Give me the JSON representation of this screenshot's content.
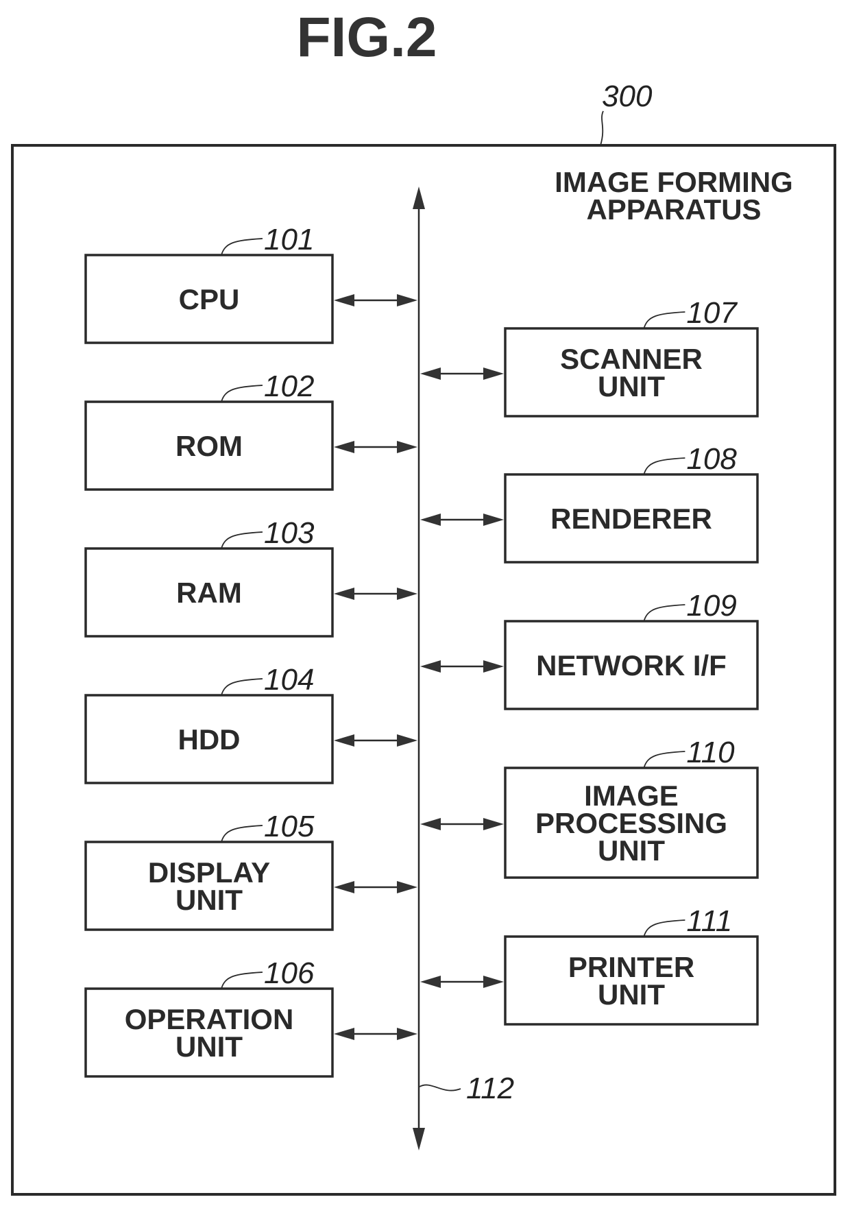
{
  "figure": {
    "title": "FIG.2",
    "apparatus_ref": "300",
    "apparatus_label": [
      "IMAGE FORMING",
      "APPARATUS"
    ],
    "bus_ref": "112"
  },
  "left_blocks": [
    {
      "ref": "101",
      "label": [
        "CPU"
      ]
    },
    {
      "ref": "102",
      "label": [
        "ROM"
      ]
    },
    {
      "ref": "103",
      "label": [
        "RAM"
      ]
    },
    {
      "ref": "104",
      "label": [
        "HDD"
      ]
    },
    {
      "ref": "105",
      "label": [
        "DISPLAY",
        "UNIT"
      ]
    },
    {
      "ref": "106",
      "label": [
        "OPERATION",
        "UNIT"
      ]
    }
  ],
  "right_blocks": [
    {
      "ref": "107",
      "label": [
        "SCANNER",
        "UNIT"
      ]
    },
    {
      "ref": "108",
      "label": [
        "RENDERER"
      ]
    },
    {
      "ref": "109",
      "label": [
        "NETWORK I/F"
      ]
    },
    {
      "ref": "110",
      "label": [
        "IMAGE",
        "PROCESSING",
        "UNIT"
      ]
    },
    {
      "ref": "111",
      "label": [
        "PRINTER",
        "UNIT"
      ]
    }
  ]
}
